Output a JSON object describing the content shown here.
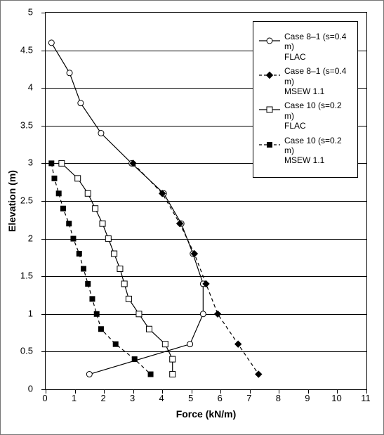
{
  "chart_data": {
    "type": "line",
    "title": "",
    "xlabel": "Force (kN/m)",
    "ylabel": "Elevation (m)",
    "xlim": [
      0,
      11
    ],
    "ylim": [
      0,
      5
    ],
    "x_ticks": [
      0,
      1,
      2,
      3,
      4,
      5,
      6,
      7,
      8,
      9,
      10,
      11
    ],
    "y_ticks": [
      0,
      0.5,
      1.0,
      1.5,
      2.0,
      2.5,
      3.0,
      3.5,
      4.0,
      4.5,
      5.0
    ],
    "grid": {
      "x": false,
      "y": true
    },
    "legend": {
      "position": "upper-right",
      "entries": [
        {
          "id": "case81_flac",
          "label_line1": "Case 8–1 (s=0.4 m)",
          "label_line2": "FLAC",
          "marker": "open-circle",
          "line": "solid"
        },
        {
          "id": "case81_msew",
          "label_line1": "Case 8–1 (s=0.4 m)",
          "label_line2": "MSEW 1.1",
          "marker": "filled-diamond",
          "line": "dashed"
        },
        {
          "id": "case10_flac",
          "label_line1": "Case 10 (s=0.2 m)",
          "label_line2": "FLAC",
          "marker": "open-square",
          "line": "solid"
        },
        {
          "id": "case10_msew",
          "label_line1": "Case 10 (s=0.2 m)",
          "label_line2": "MSEW 1.1",
          "marker": "filled-square",
          "line": "dashed"
        }
      ]
    },
    "series": [
      {
        "name": "Case 8–1 (s=0.4 m) FLAC",
        "marker": "open-circle",
        "line": "solid",
        "x": [
          0.2,
          0.82,
          1.2,
          1.9,
          2.95,
          4.05,
          4.65,
          5.05,
          5.4,
          5.4,
          4.95,
          1.5
        ],
        "y": [
          4.6,
          4.2,
          3.8,
          3.4,
          3.0,
          2.6,
          2.2,
          1.8,
          1.4,
          1.0,
          0.6,
          0.2
        ]
      },
      {
        "name": "Case 8–1 (s=0.4 m) MSEW 1.1",
        "marker": "filled-diamond",
        "line": "dashed",
        "x": [
          3.0,
          4.0,
          4.6,
          5.1,
          5.5,
          5.9,
          6.6,
          7.3
        ],
        "y": [
          3.0,
          2.6,
          2.2,
          1.8,
          1.4,
          1.0,
          0.6,
          0.2
        ]
      },
      {
        "name": "Case 10 (s=0.2 m) FLAC",
        "marker": "open-square",
        "line": "solid",
        "x": [
          0.55,
          1.1,
          1.45,
          1.7,
          1.95,
          2.15,
          2.35,
          2.55,
          2.7,
          2.85,
          3.2,
          3.55,
          4.1,
          4.35,
          4.35
        ],
        "y": [
          3.0,
          2.8,
          2.6,
          2.4,
          2.2,
          2.0,
          1.8,
          1.6,
          1.4,
          1.2,
          1.0,
          0.8,
          0.6,
          0.4,
          0.2
        ]
      },
      {
        "name": "Case 10 (s=0.2 m) MSEW 1.1",
        "marker": "filled-square",
        "line": "dashed",
        "x": [
          0.2,
          0.3,
          0.45,
          0.6,
          0.8,
          0.95,
          1.15,
          1.3,
          1.45,
          1.6,
          1.75,
          1.9,
          2.4,
          3.05,
          3.6
        ],
        "y": [
          3.0,
          2.8,
          2.6,
          2.4,
          2.2,
          2.0,
          1.8,
          1.6,
          1.4,
          1.2,
          1.0,
          0.8,
          0.6,
          0.4,
          0.2
        ]
      }
    ]
  }
}
